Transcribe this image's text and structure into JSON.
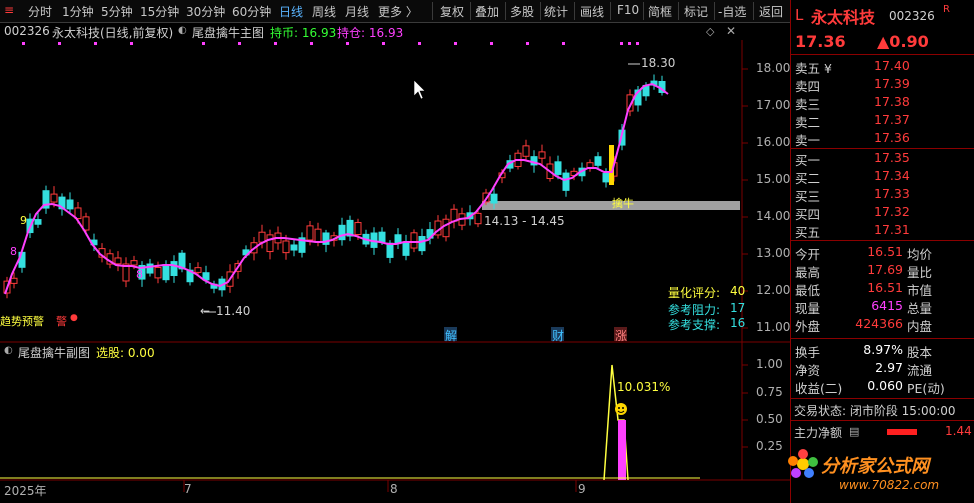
{
  "toolbar": {
    "periods": [
      "分时",
      "1分钟",
      "5分钟",
      "15分钟",
      "30分钟",
      "60分钟",
      "日线",
      "周线",
      "月线",
      "更多 〉"
    ],
    "active_period": "日线",
    "tools": [
      "复权",
      "叠加",
      "多股",
      "统计",
      "画线",
      "F10",
      "简框",
      "标记",
      "-自选",
      "返回"
    ]
  },
  "main_chart": {
    "code": "002326",
    "name_period": "永太科技(日线,前复权)",
    "indicator_name": "尾盘擒牛主图",
    "hold_coin_label": "持币: 16.93",
    "hold_stock_label": "持仓: 16.93",
    "price_axis": [
      "18.00",
      "17.00",
      "16.00",
      "15.00",
      "14.00",
      "13.00",
      "12.00",
      "11.00"
    ],
    "high_label": "18.30",
    "low_label": "11.40",
    "zone_label": "14.13 - 14.45",
    "zone_tag": "擒牛",
    "count_labels": [
      "9",
      "8",
      "8"
    ],
    "warning_label": "趋势预警",
    "warning_label2": "警",
    "event_tags": [
      "解",
      "财",
      "涨"
    ],
    "score_lines": [
      {
        "label": "量化评分:",
        "value": "40",
        "color": "#ffff40"
      },
      {
        "label": "参考阻力:",
        "value": "17",
        "color": "#34e0e0"
      },
      {
        "label": "参考支撑:",
        "value": "16",
        "color": "#34e0e0"
      }
    ]
  },
  "sub_chart": {
    "indicator_name": "尾盘擒牛副图",
    "select_label": "选股: 0.00",
    "axis": [
      "1.00",
      "0.75",
      "0.50",
      "0.25"
    ],
    "pct_label": "10.031%"
  },
  "date_axis": [
    "2025年",
    "7",
    "8",
    "9"
  ],
  "quote": {
    "title_prefix": "L",
    "stock_name": "永太科技",
    "stock_code": "002326",
    "badge_r": "R",
    "price": "17.36",
    "change": "▲0.90",
    "asks": [
      {
        "label": "卖五 ¥",
        "price": "17.40"
      },
      {
        "label": "卖四",
        "price": "17.39"
      },
      {
        "label": "卖三",
        "price": "17.38"
      },
      {
        "label": "卖二",
        "price": "17.37"
      },
      {
        "label": "卖一",
        "price": "17.36"
      }
    ],
    "bids": [
      {
        "label": "买一",
        "price": "17.35"
      },
      {
        "label": "买二",
        "price": "17.34"
      },
      {
        "label": "买三",
        "price": "17.33"
      },
      {
        "label": "买四",
        "price": "17.32"
      },
      {
        "label": "买五",
        "price": "17.31"
      }
    ],
    "stats": [
      {
        "l1": "今开",
        "v1": "16.51",
        "c1": "#ff3b3b",
        "l2": "均价"
      },
      {
        "l1": "最高",
        "v1": "17.69",
        "c1": "#ff3b3b",
        "l2": "量比"
      },
      {
        "l1": "最低",
        "v1": "16.51",
        "c1": "#ff3b3b",
        "l2": "市值"
      },
      {
        "l1": "现量",
        "v1": "6415",
        "c1": "#ff40ff",
        "l2": "总量"
      },
      {
        "l1": "外盘",
        "v1": "424366",
        "c1": "#ff3b3b",
        "l2": "内盘"
      }
    ],
    "stats2": [
      {
        "l1": "换手",
        "v1": "8.97%",
        "l2": "股本"
      },
      {
        "l1": "净资",
        "v1": "2.97",
        "l2": "流通"
      },
      {
        "l1": "收益(二)",
        "v1": "0.060",
        "l2": "PE(动)"
      }
    ],
    "trade_status": "交易状态: 闭市阶段 15:00:00",
    "main_flow_label": "主力净额",
    "main_flow_value": "1.44",
    "watermark": "分析家公式网",
    "watermark_url": "www.70822.com"
  }
}
